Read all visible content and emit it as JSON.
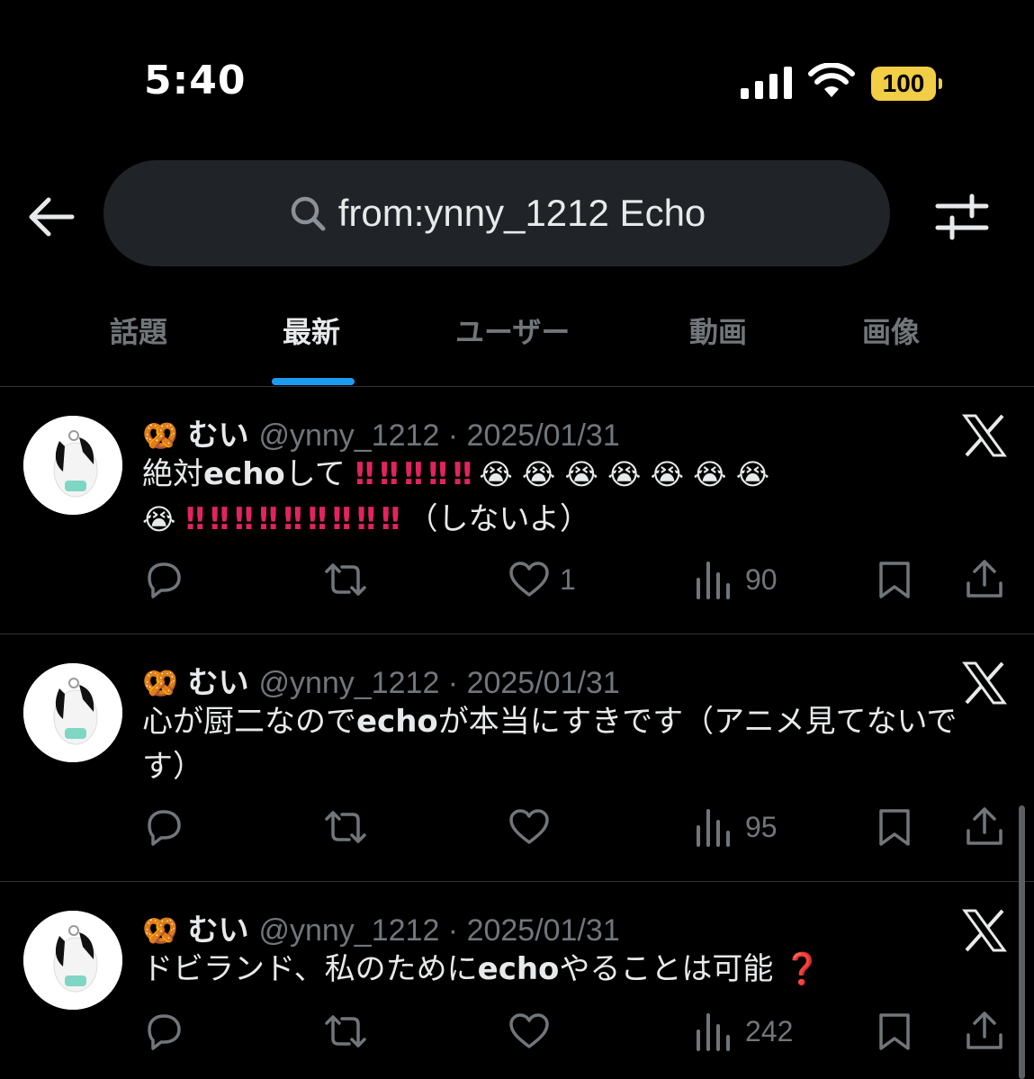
{
  "status_bar": {
    "time": "5:40",
    "battery": "100"
  },
  "search": {
    "query": "from:ynny_1212 Echo"
  },
  "tabs": [
    {
      "label": "話題"
    },
    {
      "label": "最新"
    },
    {
      "label": "ユーザー"
    },
    {
      "label": "動画"
    },
    {
      "label": "画像"
    }
  ],
  "active_tab": "最新",
  "colors": {
    "accent": "#1d9bf0",
    "muted": "#71767b",
    "battery": "#f2cd46",
    "exclamation": "#e0245e"
  },
  "tweets": [
    {
      "emoji": "🥨",
      "name": "むい",
      "handle": "@ynny_1212 · 2025/01/31",
      "text_pre": "絶対",
      "text_bold": "echo",
      "text_post": "して",
      "line1_bangs": "‼ ‼ ‼ ‼ ‼",
      "line1_cry": "😭 😭 😭 😭 😭 😭 😭",
      "line2_cry": "😭",
      "line2_bangs": "‼ ‼ ‼ ‼ ‼ ‼ ‼ ‼ ‼",
      "line2_tail": "（しないよ）",
      "likes": "1",
      "views": "90"
    },
    {
      "emoji": "🥨",
      "name": "むい",
      "handle": "@ynny_1212 · 2025/01/31",
      "text_pre": "心が厨二なので",
      "text_bold": "echo",
      "text_post": "が本当にすきです（アニメ見てないです）",
      "likes": "",
      "views": "95"
    },
    {
      "emoji": "🥨",
      "name": "むい",
      "handle": "@ynny_1212 · 2025/01/31",
      "text_pre": "ドビランド、私のために",
      "text_bold": "echo",
      "text_post": "やることは可能",
      "text_mark": "❓",
      "likes": "",
      "views": "242"
    }
  ]
}
